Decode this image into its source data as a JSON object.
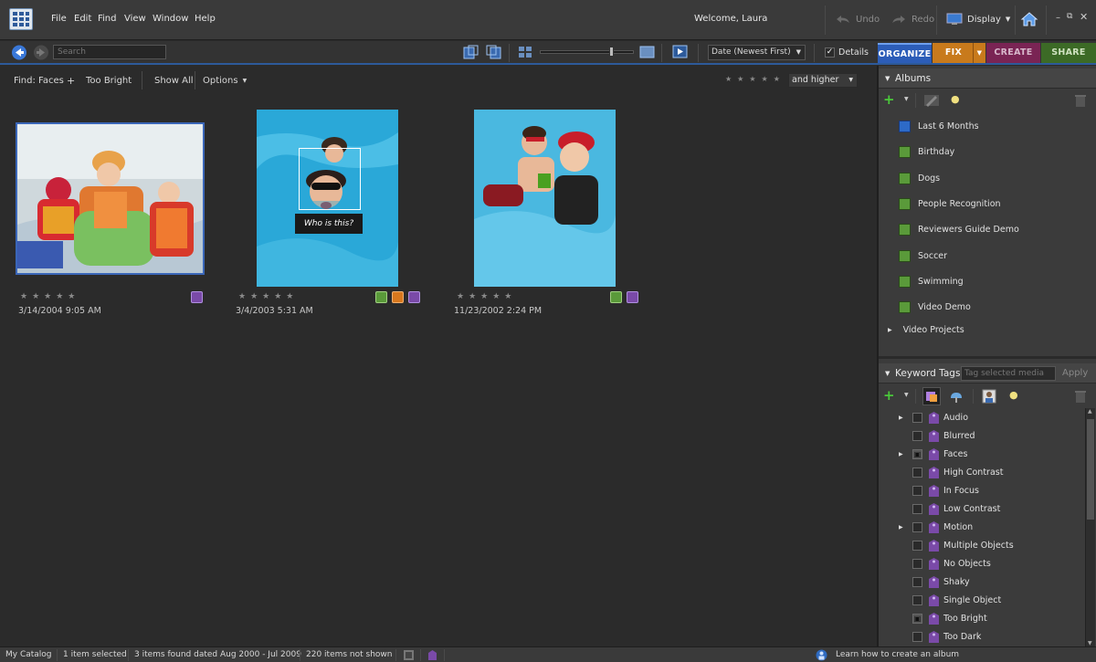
{
  "menu": {
    "items": [
      "File",
      "Edit",
      "Find",
      "View",
      "Window",
      "Help"
    ],
    "welcome": "Welcome, Laura",
    "undo": "Undo",
    "redo": "Redo",
    "display": "Display"
  },
  "toolbar": {
    "search_placeholder": "Search",
    "sort": "Date (Newest First)",
    "details_label": "Details",
    "details_checked": true
  },
  "workspace_tabs": [
    {
      "label": "ORGANIZE",
      "color": "#2c5db8"
    },
    {
      "label": "FIX",
      "color": "#c87a1c"
    },
    {
      "label": "CREATE",
      "color": "#7a2454"
    },
    {
      "label": "SHARE",
      "color": "#3c6a26"
    }
  ],
  "findbar": {
    "find_label": "Find: Faces",
    "plus": "+",
    "criteria": "Too Bright",
    "show_all": "Show All",
    "options": "Options",
    "rating_filter": "and higher"
  },
  "photos": [
    {
      "date": "3/14/2004 9:05 AM",
      "rating": 0,
      "selected": true,
      "tags": [
        "keyword-tag-icon"
      ]
    },
    {
      "date": "3/4/2003 5:31 AM",
      "rating": 0,
      "selected": false,
      "face_prompt": "Who is this?",
      "tags": [
        "album-icon",
        "favorite-tag-icon",
        "keyword-tag-icon"
      ]
    },
    {
      "date": "11/23/2002 2:24 PM",
      "rating": 0,
      "selected": false,
      "tags": [
        "album-icon",
        "keyword-tag-icon"
      ]
    }
  ],
  "albums": {
    "header": "Albums",
    "items": [
      {
        "label": "Last 6 Months",
        "icon": "smart-album-icon"
      },
      {
        "label": "Birthday",
        "icon": "album-icon"
      },
      {
        "label": "Dogs",
        "icon": "album-icon"
      },
      {
        "label": "People Recognition",
        "icon": "album-icon"
      },
      {
        "label": "Reviewers Guide Demo",
        "icon": "album-icon"
      },
      {
        "label": "Soccer",
        "icon": "album-icon"
      },
      {
        "label": "Swimming",
        "icon": "album-icon"
      },
      {
        "label": "Video Demo",
        "icon": "album-icon"
      }
    ],
    "group": "Video Projects"
  },
  "keywords": {
    "header": "Keyword Tags",
    "tag_placeholder": "Tag selected media",
    "apply": "Apply",
    "items": [
      {
        "label": "Audio",
        "expandable": true,
        "checked": false
      },
      {
        "label": "Blurred",
        "expandable": false,
        "checked": false
      },
      {
        "label": "Faces",
        "expandable": true,
        "checked": true
      },
      {
        "label": "High Contrast",
        "expandable": false,
        "checked": false
      },
      {
        "label": "In Focus",
        "expandable": false,
        "checked": false
      },
      {
        "label": "Low Contrast",
        "expandable": false,
        "checked": false
      },
      {
        "label": "Motion",
        "expandable": true,
        "checked": false
      },
      {
        "label": "Multiple Objects",
        "expandable": false,
        "checked": false
      },
      {
        "label": "No Objects",
        "expandable": false,
        "checked": false
      },
      {
        "label": "Shaky",
        "expandable": false,
        "checked": false
      },
      {
        "label": "Single Object",
        "expandable": false,
        "checked": false
      },
      {
        "label": "Too Bright",
        "expandable": false,
        "checked": true
      },
      {
        "label": "Too Dark",
        "expandable": false,
        "checked": false
      }
    ]
  },
  "status": {
    "catalog": "My Catalog",
    "selected": "1 item selected",
    "found": "3 items found dated Aug 2000 - Jul 2009",
    "not_shown": "220 items not shown",
    "tip": "Learn how to create an album"
  },
  "colors": {
    "accent": "#2d5a9a",
    "album_green": "#5a9a3a",
    "keyword_purple": "#7a4aa8",
    "favorite_orange": "#d8781e"
  }
}
